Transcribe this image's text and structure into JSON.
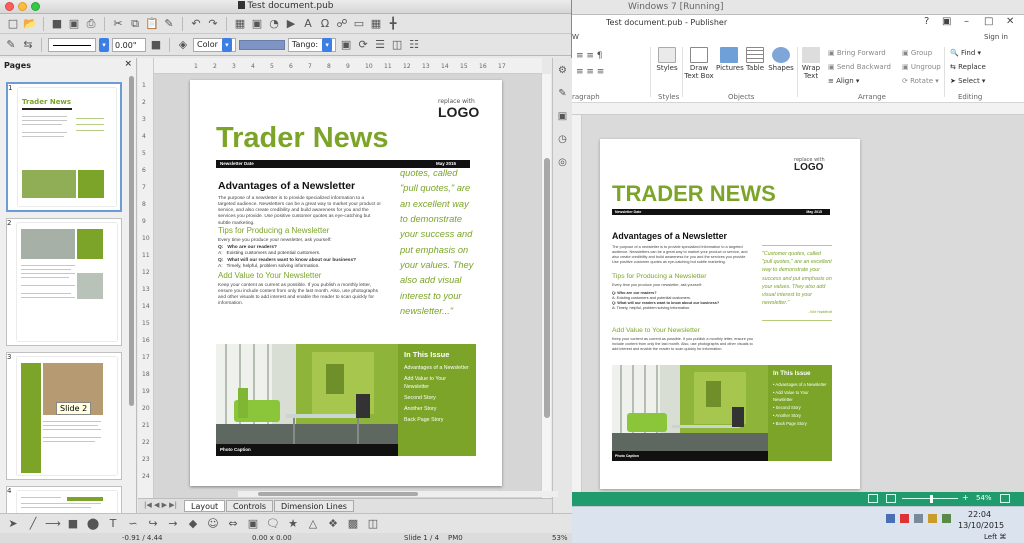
{
  "lo": {
    "title": "Test document.pub",
    "pages_header": "Pages",
    "pages_close": "×",
    "thumb_numbers": [
      "1",
      "2",
      "3",
      "4"
    ],
    "tooltip": "Slide 2",
    "line_width": "0.00\"",
    "color_mode": "Color",
    "color_name": "Tango:",
    "tabs": [
      "Layout",
      "Controls",
      "Dimension Lines"
    ],
    "status": {
      "position": "-0.91 / 4.44",
      "size": "0.00 x 0.00",
      "slide": "Slide 1 / 4",
      "master": "PM0",
      "zoom": "53%"
    },
    "ruler_h": [
      "1",
      "2",
      "3",
      "4",
      "5",
      "6",
      "7",
      "8",
      "9",
      "10",
      "11",
      "12",
      "13",
      "14",
      "15",
      "16",
      "17"
    ],
    "ruler_v": [
      "1",
      "2",
      "3",
      "4",
      "5",
      "6",
      "7",
      "8",
      "9",
      "10",
      "11",
      "12",
      "13",
      "14",
      "15",
      "16",
      "17",
      "18",
      "19",
      "20",
      "21",
      "22",
      "23",
      "24"
    ]
  },
  "newsletter": {
    "logo_small": "replace with",
    "logo_big": "LOGO",
    "title": "Trader News",
    "bar_left": "Newsletter Date",
    "bar_right": "May 2015",
    "heading1": "Advantages of a Newsletter",
    "body1": "The purpose of a newsletter is to provide specialized information to a targeted audience. Newsletters can be a great way to market your product or service, and also create credibility and build awareness for you and the services you provide. Use positive customer quotes as eye-catching but subtle marketing.",
    "heading2": "Tips for Producing a Newsletter",
    "body2": "Every time you produce your newsletter, ask yourself:",
    "q1": "Who are our readers?",
    "a1": "Existing customers and potential customers.",
    "q2": "What will our readers want to know about our business?",
    "a2": "Timely, helpful, problem solving information.",
    "q_label": "Q:",
    "a_label": "A:",
    "heading3": "Add Value to Your Newsletter",
    "body3": "Keep your content as current as possible. If you publish a monthly letter, ensure you include content from only the last month. Also, use photographs and other visuals to add interest and enable the reader to scan quickly for information.",
    "pull_quote": "quotes, called \"pull quotes,\" are an excellent way to demonstrate your success and put emphasis on your values. They also add visual interest to your newsletter...\"",
    "photo_caption": "Photo Caption",
    "issue_title": "In This Issue",
    "issue_items": [
      "Advantages of a Newsletter",
      "Add Value to Your Newsletter",
      "Second Story",
      "Another Story",
      "Back Page Story"
    ],
    "thumb_title": "Trader News"
  },
  "win": {
    "vm_title": "Windows 7 [Running]",
    "title": "Test document.pub - Publisher",
    "sign_in": "Sign in",
    "ribbon_left": "W",
    "groups": [
      "ragraph",
      "Styles",
      "Objects",
      "Arrange",
      "Editing"
    ],
    "buttons": {
      "styles": "Styles",
      "draw_text_box": "Draw Text Box",
      "pictures": "Pictures",
      "table": "Table",
      "shapes": "Shapes",
      "wrap_text": "Wrap Text",
      "bring_forward": "Bring Forward",
      "send_backward": "Send Backward",
      "align": "Align",
      "group": "Group",
      "ungroup": "Ungroup",
      "rotate": "Rotate",
      "find": "Find",
      "replace": "Replace",
      "select": "Select"
    },
    "pub_title": "TRADER NEWS",
    "pull_quote": "\"Customer quotes, called \"pull quotes,\" are an excellent way to demonstrate your success and put emphasis on your values. They also add visual interest to your newsletter.\"",
    "quote_attrib": "- Kirk Haddicott",
    "zoom": "54%",
    "time": "22:04",
    "date": "13/10/2015",
    "lang": "Left ⌘"
  },
  "colors": {
    "accent": "#7ba428",
    "taskbar": "#dbe3ee",
    "statusbar": "#1f9b6d"
  }
}
